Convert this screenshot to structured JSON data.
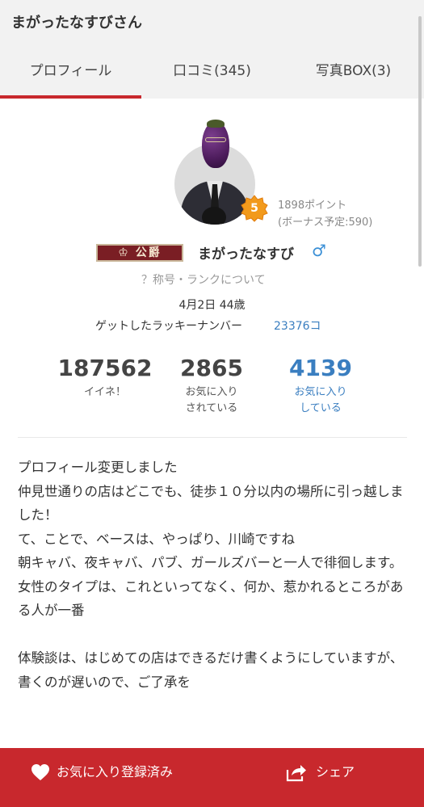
{
  "header": {
    "title": "まがったなすびさん"
  },
  "tabs": [
    {
      "label": "プロフィール",
      "active": true
    },
    {
      "label": "口コミ(345)",
      "active": false
    },
    {
      "label": "写真BOX(3)",
      "active": false
    }
  ],
  "profile": {
    "rank": "5",
    "points": "1898ポイント",
    "bonus": "(ボーナス予定:590)",
    "title_badge": "公爵",
    "name": "まがったなすび",
    "gender_symbol": "♂",
    "rank_link": "？称号・ランクについて",
    "birth": "4月2日 44歳",
    "lucky_label": "ゲットしたラッキーナンバー",
    "lucky_number": "23376コ"
  },
  "stats": [
    {
      "value": "187562",
      "label1": "イイネ！",
      "label2": ""
    },
    {
      "value": "2865",
      "label1": "お気に入り",
      "label2": "されている"
    },
    {
      "value": "4139",
      "label1": "お気に入り",
      "label2": "している"
    }
  ],
  "bio": [
    "プロフィール変更しました",
    "仲見世通りの店はどこでも、徒歩１０分以内の場所に引っ越しました！",
    "て、ことで、ベースは、やっぱり、川崎ですね",
    "朝キャバ、夜キャバ、パブ、ガールズバーと一人で徘徊します。",
    "女性のタイプは、これといってなく、何か、惹かれるところがある人が一番",
    "",
    "体験談は、はじめての店はできるだけ書くようにしていますが、書くのが遅いので、ご了承を"
  ],
  "bottom": {
    "favorite_label": "お気に入り登録済み",
    "share_label": "シェア"
  },
  "colors": {
    "accent": "#c8282d",
    "link_blue": "#3a7ec0",
    "gender_blue": "#3a8fd6",
    "rank_badge": "#f29a1c"
  }
}
